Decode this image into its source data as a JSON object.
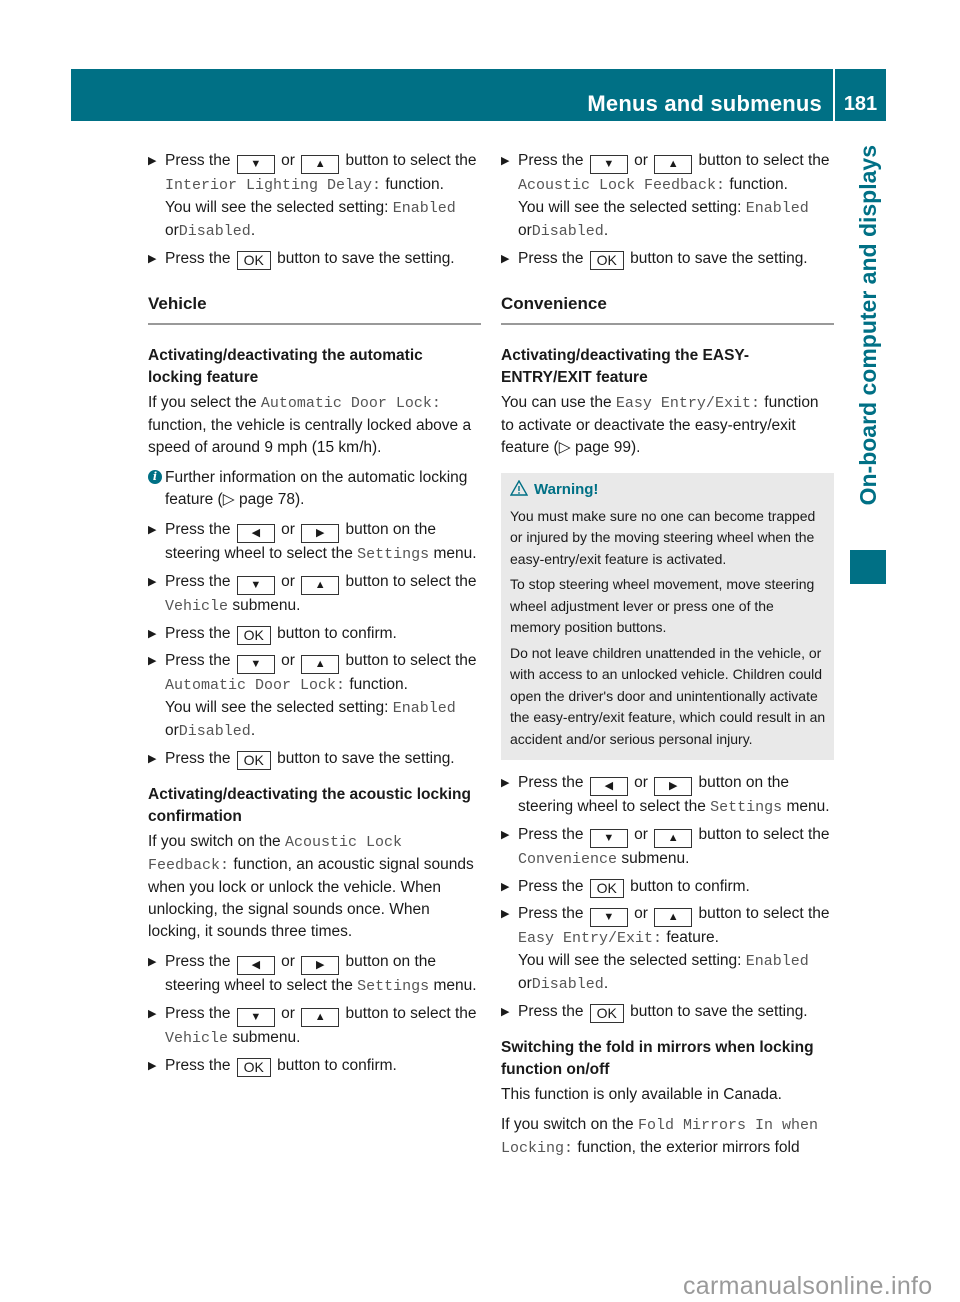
{
  "header": {
    "title": "Menus and submenus",
    "page_number": "181",
    "accent_color": "#007085"
  },
  "side_tab": {
    "label": "On-board computer and displays"
  },
  "buttons": {
    "down": "▼",
    "up": "▲",
    "left": "◀",
    "right": "▶",
    "ok": "OK"
  },
  "common": {
    "press_the": "Press the",
    "or": "or",
    "button_to_select_the": "button to select the",
    "button_on_the": "button on the",
    "steering_wheel_select": "steering wheel to select the",
    "settings": "Settings",
    "menu": "menu.",
    "submenu": "submenu.",
    "button_to_confirm": "button to confirm.",
    "button_to_save": "button to save the setting.",
    "function": "function.",
    "feature": "feature.",
    "you_will_see": "You will see the selected setting:",
    "enabled": "Enabled",
    "or_word": "or",
    "disabled": "Disabled",
    "period": "."
  },
  "left_column": {
    "intro_step_function": "Interior Lighting Delay:",
    "section_vehicle": "Vehicle",
    "autolock": {
      "heading": "Activating/deactivating the automatic locking feature",
      "para_pre": "If you select the",
      "para_code": "Automatic Door Lock:",
      "para_post": "function, the vehicle is centrally locked above a speed of around 9 mph (15 km/h).",
      "info_text": "Further information on the automatic locking feature (▷ page 78).",
      "submenu_name": "Vehicle",
      "function_name": "Automatic Door Lock:"
    },
    "acoustic": {
      "heading": "Activating/deactivating the acoustic locking confirmation",
      "para_pre": "If you switch on the",
      "para_code": "Acoustic Lock Feedback:",
      "para_post": "function, an acoustic signal sounds when you lock or unlock the vehicle. When unlocking, the signal sounds once. When locking, it sounds three times.",
      "submenu_name": "Vehicle"
    }
  },
  "right_column": {
    "acoustic_function": "Acoustic Lock Feedback:",
    "section_convenience": "Convenience",
    "easy_entry": {
      "heading": "Activating/deactivating the EASY-ENTRY/EXIT feature",
      "para_pre": "You can use the",
      "para_code": "Easy Entry/Exit:",
      "para_post": "function to activate or deactivate the easy-entry/exit feature (▷ page 99).",
      "submenu_name": "Convenience",
      "feature_name": "Easy Entry/Exit:"
    },
    "warning": {
      "title": "Warning!",
      "paragraphs": [
        "You must make sure no one can become trapped or injured by the moving steering wheel when the easy-entry/exit feature is activated.",
        "To stop steering wheel movement, move steering wheel adjustment lever or press one of the memory position buttons.",
        "Do not leave children unattended in the vehicle, or with access to an unlocked vehicle. Children could open the driver's door and unintentionally activate the easy-entry/exit feature, which could result in an accident and/or serious personal injury."
      ]
    },
    "mirrors": {
      "heading": "Switching the fold in mirrors when locking function on/off",
      "para1": "This function is only available in Canada.",
      "para_pre": "If you switch on the",
      "para_code": "Fold Mirrors In when Locking:",
      "para_post": "function, the exterior mirrors fold"
    }
  },
  "watermark": "carmanualsonline.info"
}
